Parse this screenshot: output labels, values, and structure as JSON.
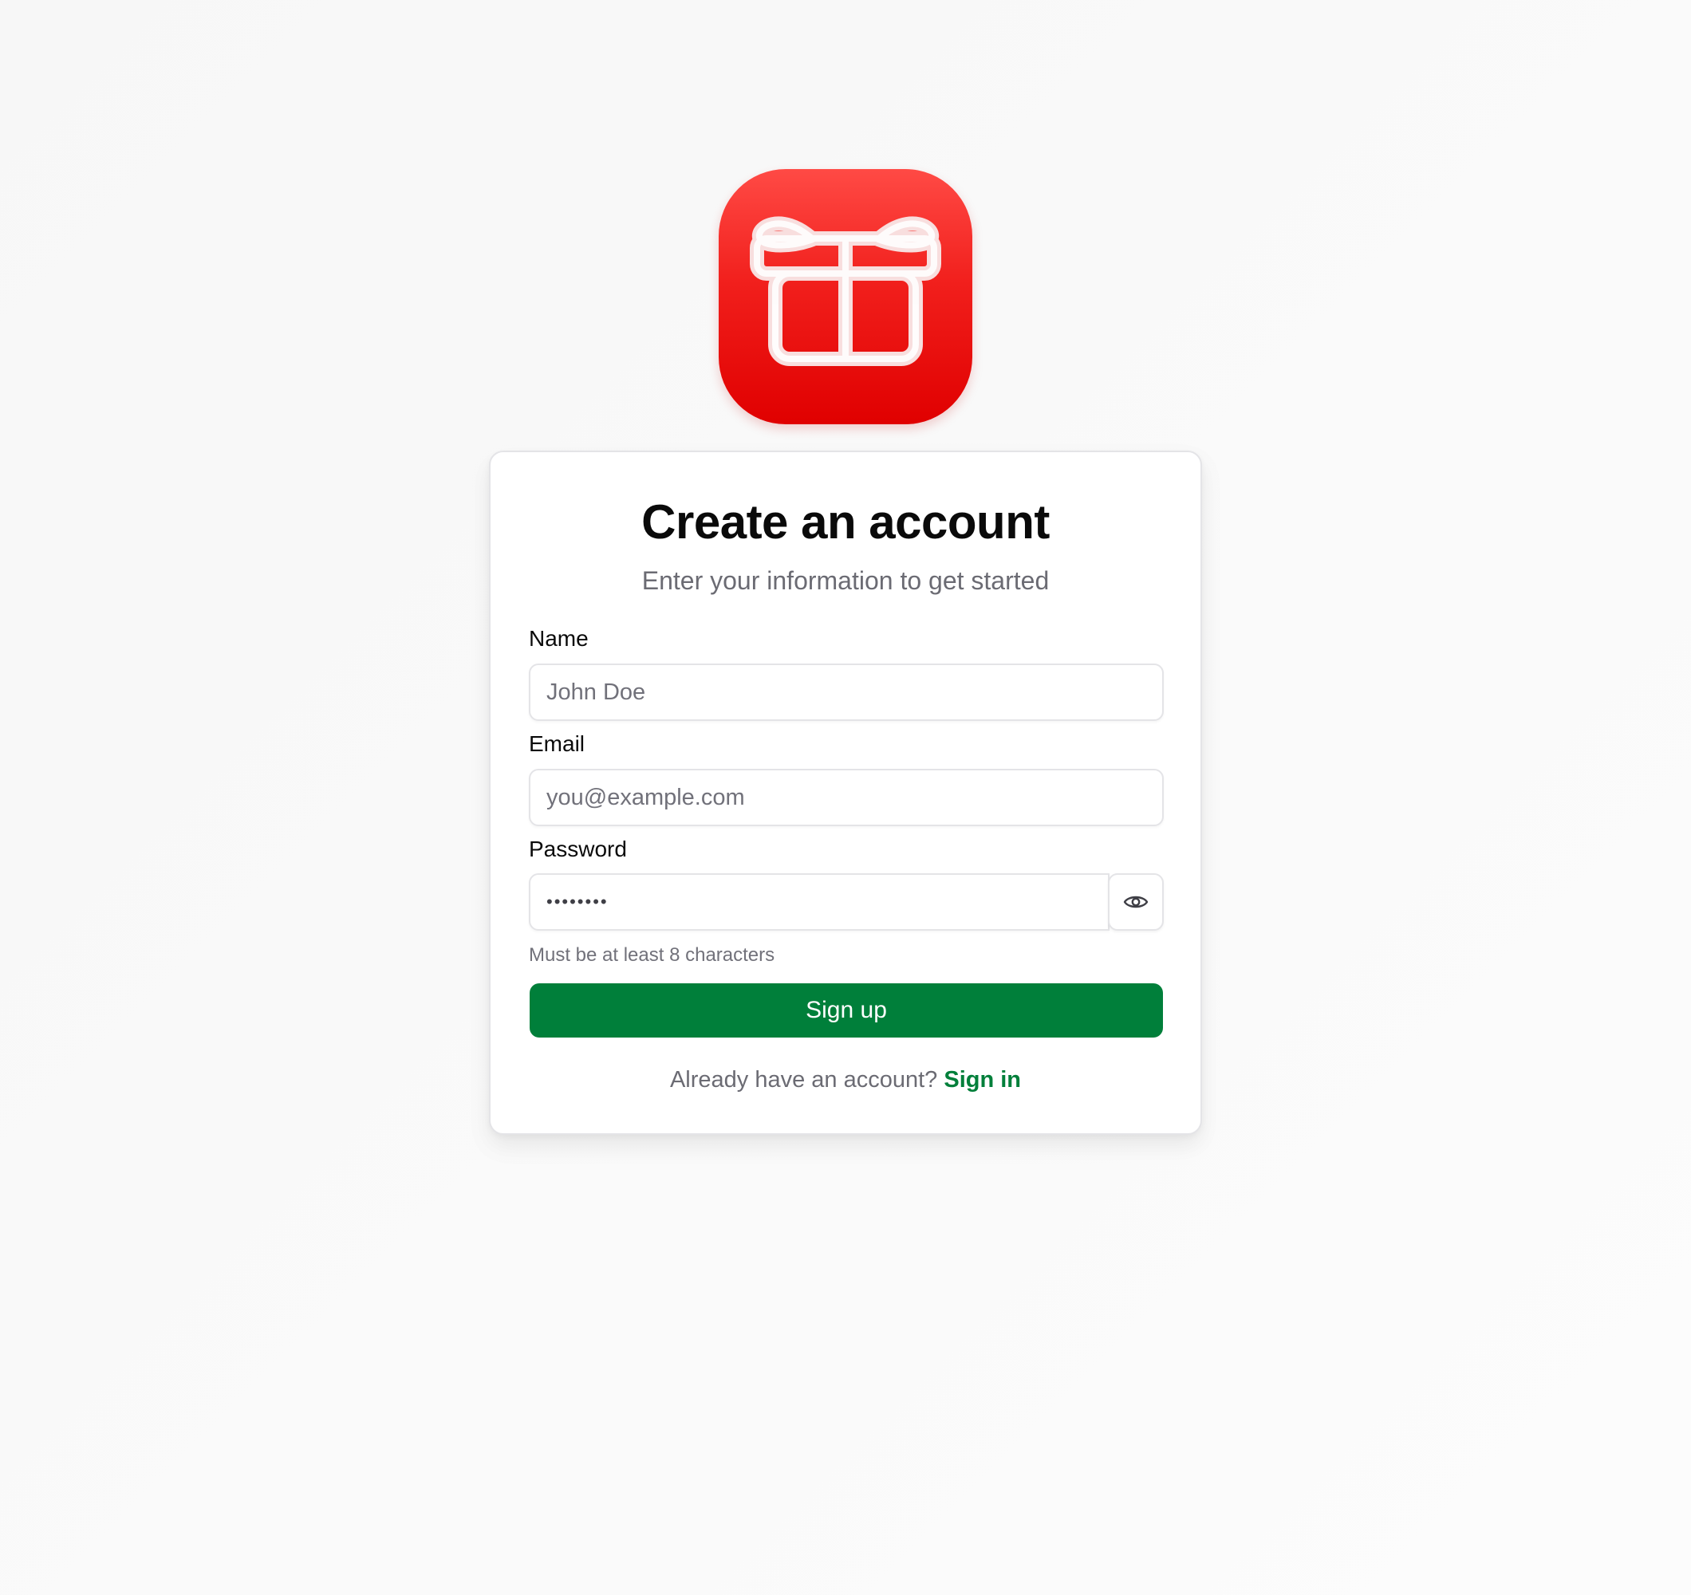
{
  "app_icon": {
    "name": "gift-icon",
    "background": "#e80808",
    "glyph_color": "#ffffff"
  },
  "form": {
    "title": "Create an account",
    "subtitle": "Enter your information to get started",
    "name": {
      "label": "Name",
      "placeholder": "John Doe"
    },
    "email": {
      "label": "Email",
      "placeholder": "you@example.com"
    },
    "password": {
      "label": "Password",
      "value": "••••••••",
      "toggle_icon": "eye-icon",
      "hint": "Must be at least 8 characters"
    },
    "submit_label": "Sign up",
    "footer_text": "Already have an account?",
    "footer_link": "Sign in"
  },
  "colors": {
    "primary": "#007f3a",
    "border": "#e4e4e7",
    "muted_text": "#6b6b73",
    "heading": "#0a0a0a"
  }
}
